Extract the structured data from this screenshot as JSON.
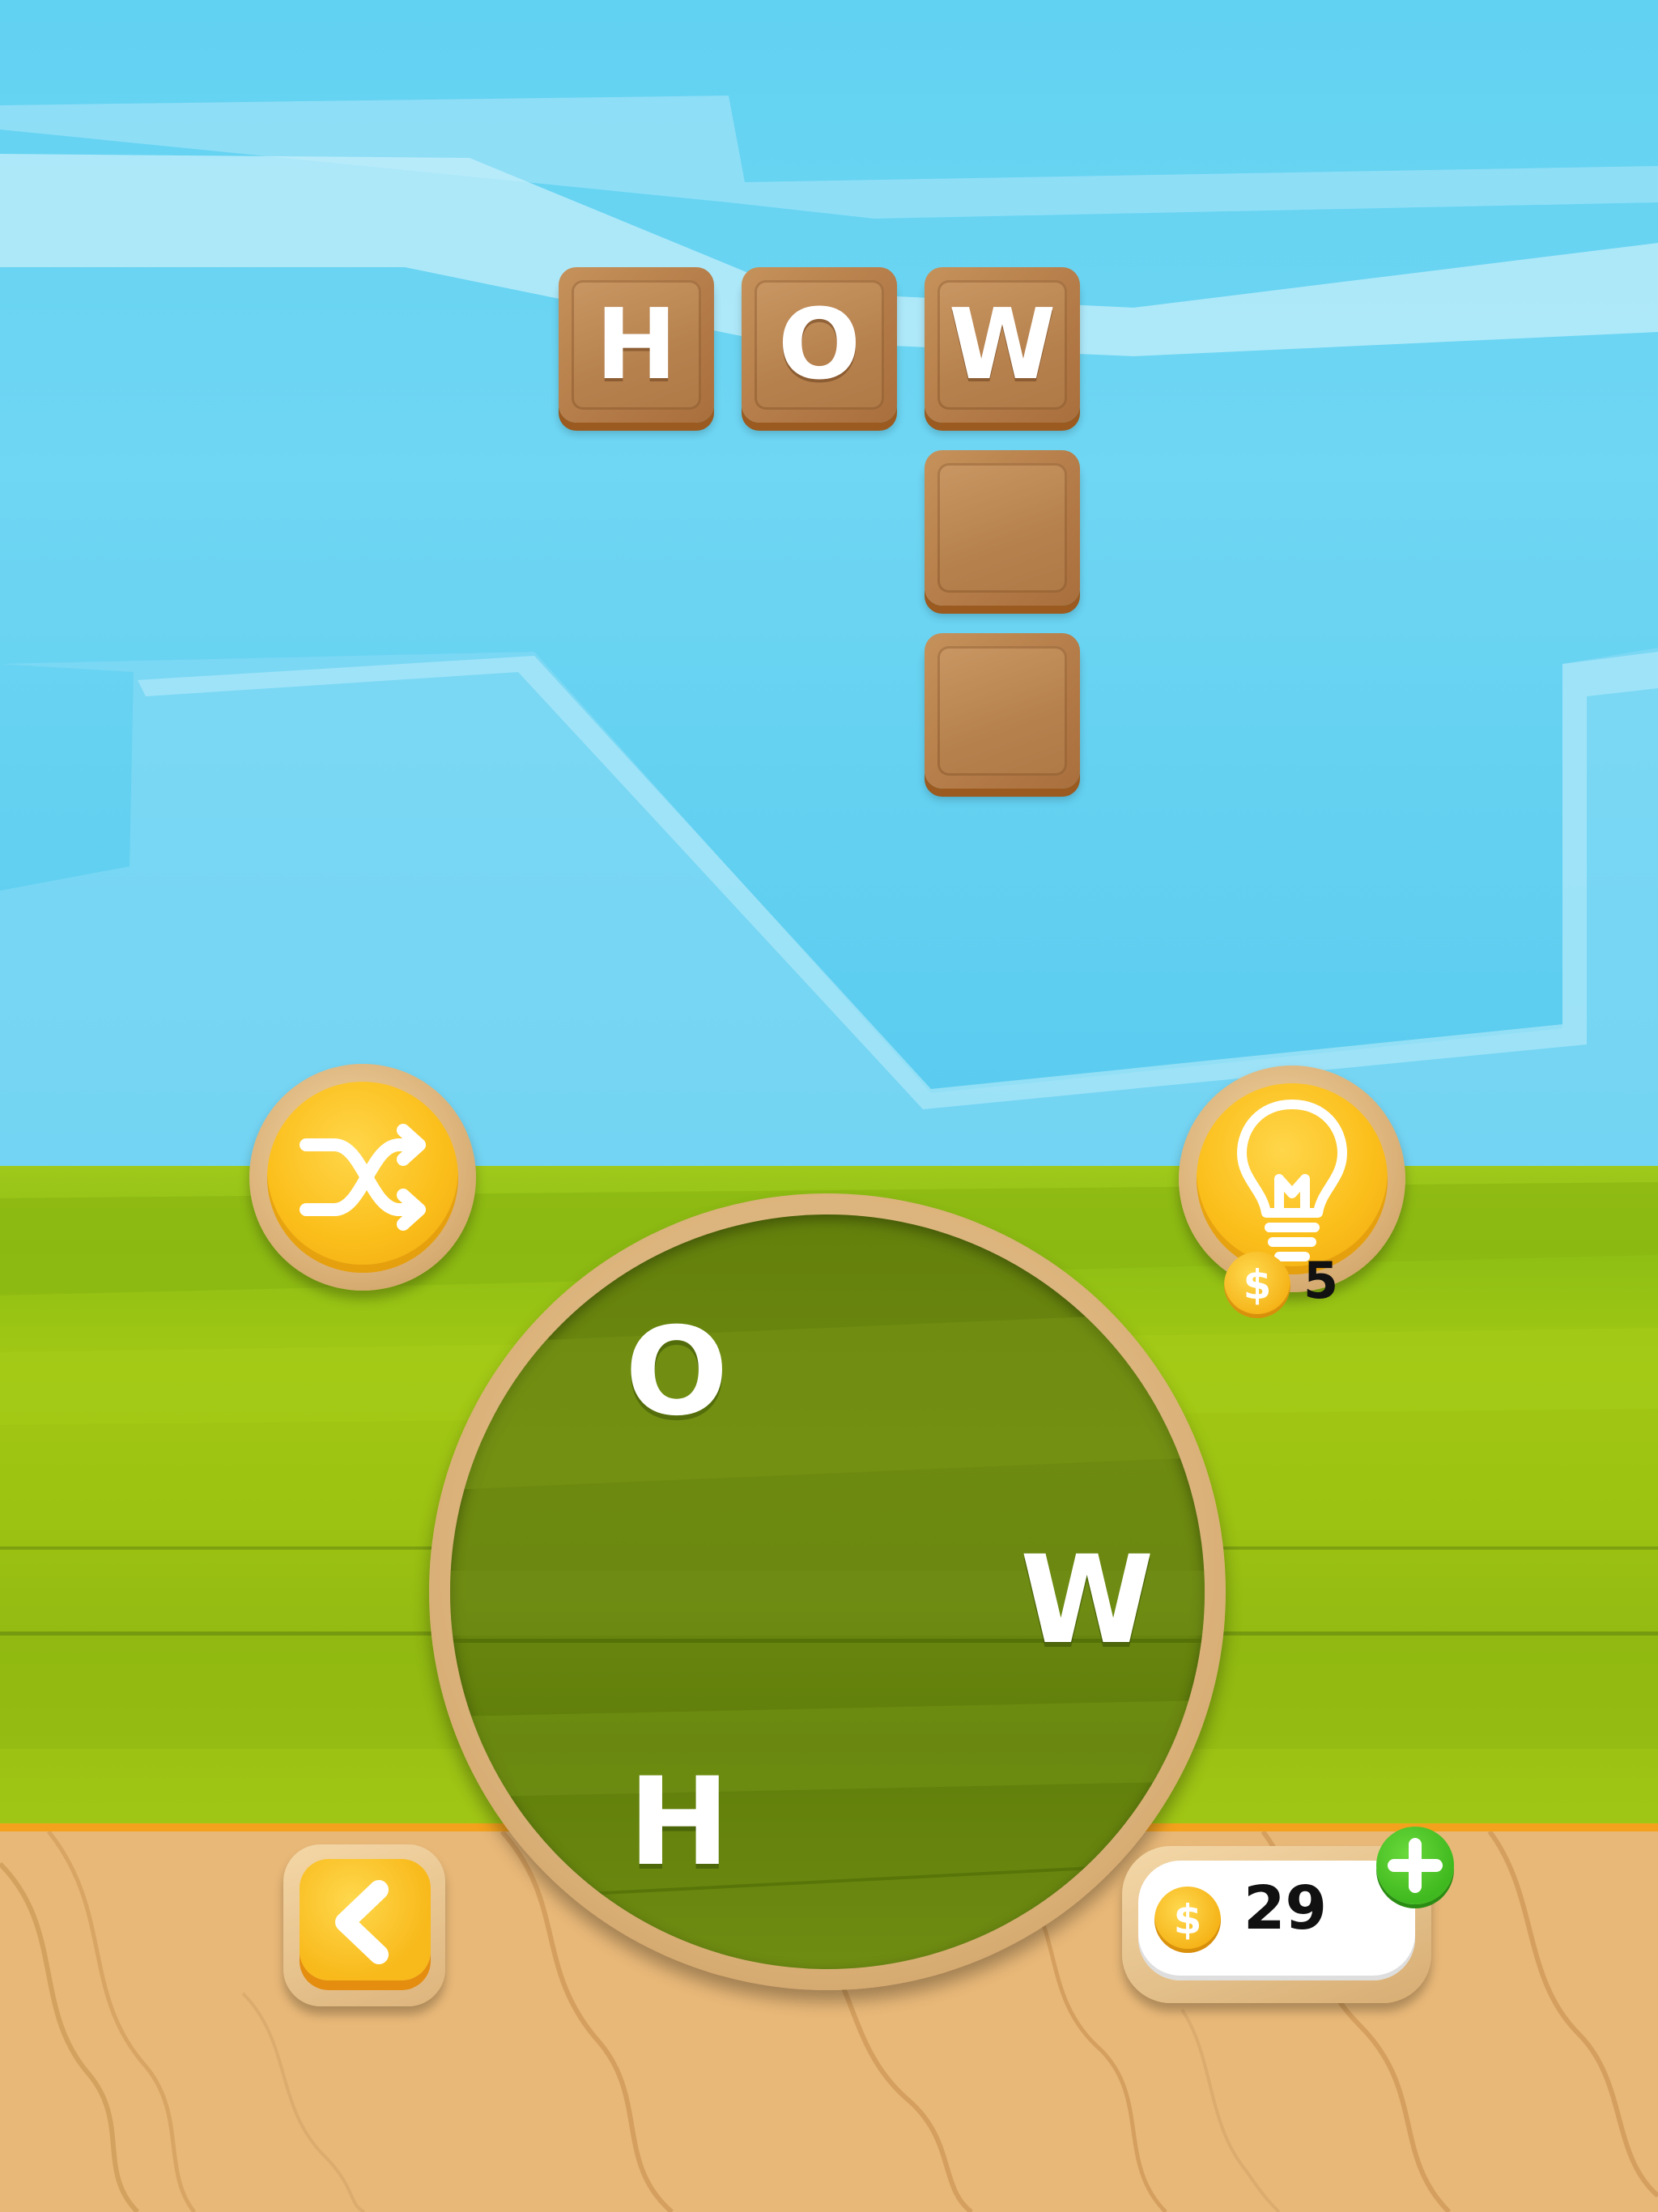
{
  "board": {
    "row_letters": [
      "H",
      "O",
      "W"
    ],
    "column_tiles_empty": 2
  },
  "wheel": {
    "letters": [
      "O",
      "W",
      "H"
    ]
  },
  "buttons": {
    "shuffle": "shuffle-icon",
    "hint": "lightbulb-icon",
    "back": "chevron-left-icon",
    "add_coins": "plus-icon"
  },
  "hint": {
    "currency_symbol": "$",
    "cost": "5"
  },
  "coins": {
    "currency_symbol": "$",
    "count": "29"
  },
  "colors": {
    "sky": "#62d2f2",
    "grass": "#9fc91b",
    "wood": "#e8b878",
    "button_yellow": "#fbbf1b",
    "plus_green": "#3fb91f"
  }
}
